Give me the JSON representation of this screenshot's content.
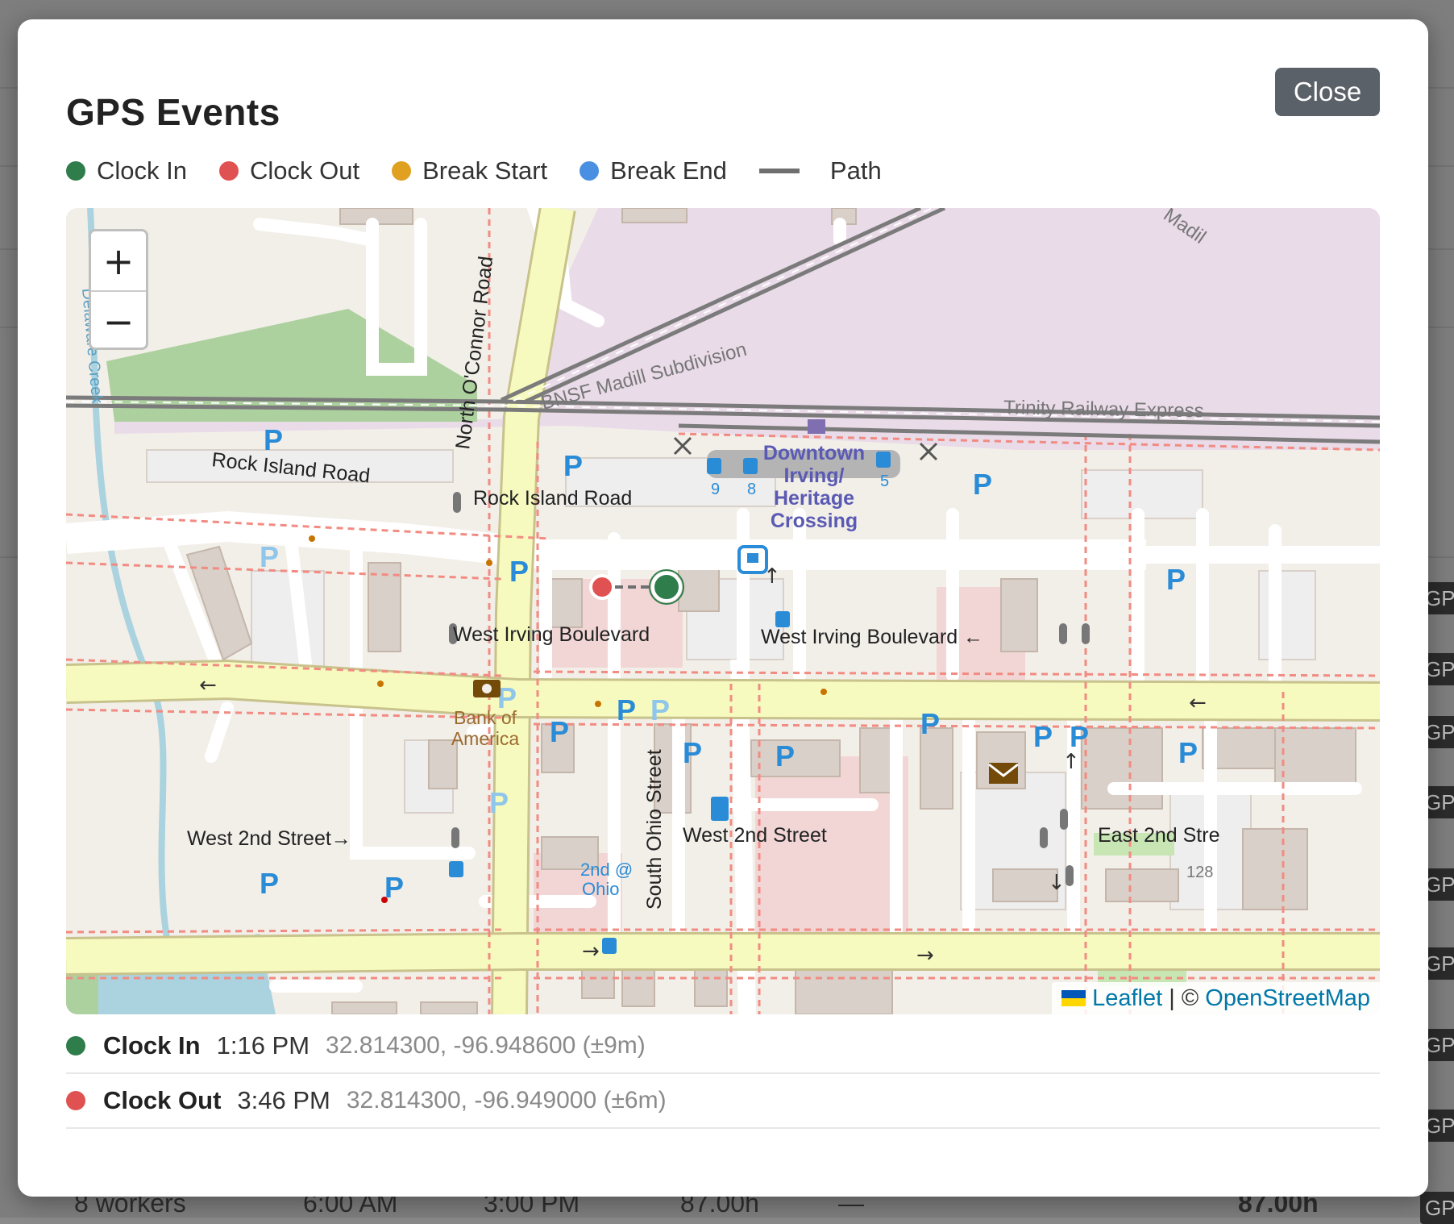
{
  "background": {
    "footer": {
      "workers": "8 workers",
      "start": "6:00 AM",
      "end": "3:00 PM",
      "hours": "87.00h",
      "dash": "—",
      "total": "87.00h"
    },
    "badge_text": "GPS"
  },
  "modal": {
    "title": "GPS Events",
    "close_label": "Close"
  },
  "legend": [
    {
      "label": "Clock In",
      "color": "#2e7d4a"
    },
    {
      "label": "Clock Out",
      "color": "#e05252"
    },
    {
      "label": "Break Start",
      "color": "#e0a020"
    },
    {
      "label": "Break End",
      "color": "#4a90e2"
    },
    {
      "label": "Path",
      "color": "#6f6f6f"
    }
  ],
  "map": {
    "zoom_in": "+",
    "zoom_out": "−",
    "attribution": {
      "leaflet": "Leaflet",
      "separator": " | © ",
      "osm": "OpenStreetMap"
    },
    "labels": {
      "north_oconnor": "North O'Connor Road",
      "rock_island_left": "Rock Island Road",
      "rock_island_right": "Rock Island Road",
      "bnsf": "BNSF Madill Subdivision",
      "tre": "Trinity Railway Express",
      "downtown_1": "Downtown",
      "downtown_2": "Irving/",
      "downtown_3": "Heritage",
      "downtown_4": "Crossing",
      "wib_left": "West Irving Boulevard",
      "wib_right": "West Irving Boulevard ←",
      "w2nd_left": "West 2nd Street→",
      "w2nd_mid": "West 2nd Street",
      "e2nd": "East 2nd Stre",
      "south_ohio": "South Ohio Street",
      "bank_1": "Bank of",
      "bank_2": "America",
      "stop_1": "2nd @",
      "stop_2": "Ohio",
      "creek": "Delaware Creek",
      "madill_corner": "Madil",
      "route9": "9",
      "route8": "8",
      "route5": "5",
      "house_128": "128"
    }
  },
  "events": [
    {
      "label": "Clock In",
      "time": "1:16 PM",
      "coords": "32.814300, -96.948600 (±9m)",
      "color": "#2e7d4a"
    },
    {
      "label": "Clock Out",
      "time": "3:46 PM",
      "coords": "32.814300, -96.949000 (±6m)",
      "color": "#e05252"
    }
  ]
}
